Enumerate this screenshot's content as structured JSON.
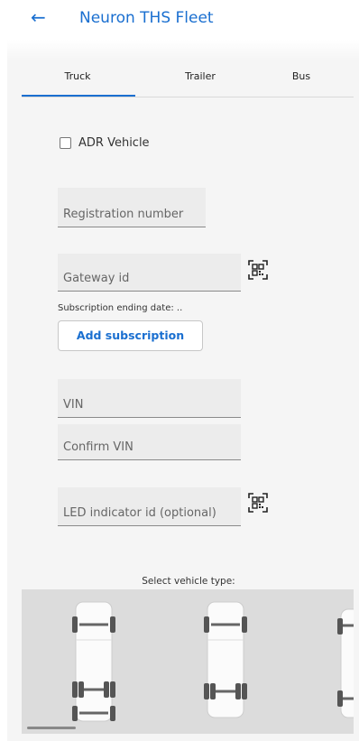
{
  "header": {
    "back_icon": "arrow-left-icon",
    "title": "Neuron THS Fleet"
  },
  "tabs": [
    {
      "label": "Truck",
      "active": true
    },
    {
      "label": "Trailer",
      "active": false
    },
    {
      "label": "Bus",
      "active": false
    }
  ],
  "form": {
    "adr_label": "ADR Vehicle",
    "adr_checked": false,
    "registration_placeholder": "Registration number",
    "gateway_placeholder": "Gateway id",
    "subscription_text": "Subscription ending date: ..",
    "add_subscription_label": "Add subscription",
    "vin_placeholder": "VIN",
    "confirm_vin_placeholder": "Confirm VIN",
    "led_placeholder": "LED indicator id (optional)",
    "qr_icon": "qr-scan-icon"
  },
  "vehicle_types": {
    "label": "Select vehicle type:",
    "options": [
      "truck-3-axle",
      "truck-2-axle",
      "truck-partial"
    ]
  },
  "colors": {
    "accent": "#1a6fd0",
    "field_bg": "#ececec",
    "strip_bg": "#dcdcdc"
  }
}
